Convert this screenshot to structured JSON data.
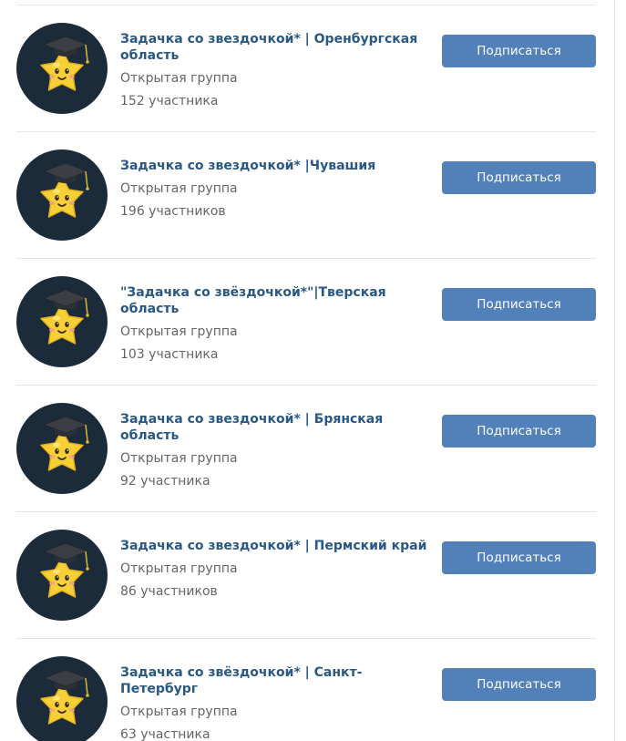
{
  "groups": [
    {
      "name": "Задачка со звездочкой* | Оренбургская область",
      "type": "Открытая группа",
      "members": "152 участника",
      "button": "Подписаться"
    },
    {
      "name": "Задачка со звездочкой* |Чувашия",
      "type": "Открытая группа",
      "members": "196 участников",
      "button": "Подписаться"
    },
    {
      "name": "\"Задачка со звёздочкой*\"|Тверская область",
      "type": "Открытая группа",
      "members": "103 участника",
      "button": "Подписаться"
    },
    {
      "name": "Задачка со звездочкой* | Брянская область",
      "type": "Открытая группа",
      "members": "92 участника",
      "button": "Подписаться"
    },
    {
      "name": "Задачка со звездочкой* | Пермский край",
      "type": "Открытая группа",
      "members": "86 участников",
      "button": "Подписаться"
    },
    {
      "name": "Задачка со звёздочкой* | Санкт-Петербург",
      "type": "Открытая группа",
      "members": "63 участника",
      "button": "Подписаться"
    }
  ],
  "colors": {
    "link": "#2a5885",
    "button": "#5181b8",
    "meta": "#656565",
    "divider": "#e7e8ec",
    "avatar_bg": "#1c2b3a",
    "star": "#f7cf36"
  },
  "icons": {
    "avatar": "star-with-graduation-cap-icon"
  }
}
